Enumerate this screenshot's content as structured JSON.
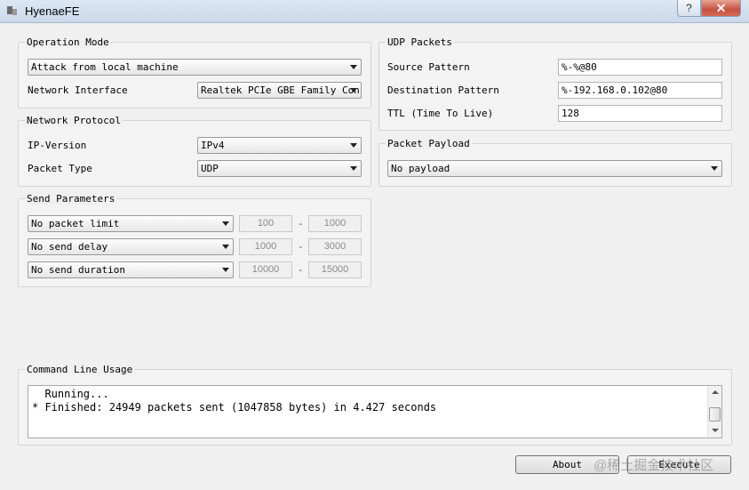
{
  "window": {
    "title": "HyenaeFE",
    "help_label": "?",
    "close_label": "✕"
  },
  "operation_mode": {
    "title": "Operation Mode",
    "mode_value": "Attack from local machine",
    "interface_label": "Network Interface",
    "interface_value": "Realtek PCIe GBE Family Con"
  },
  "network_protocol": {
    "title": "Network Protocol",
    "ip_version_label": "IP-Version",
    "ip_version_value": "IPv4",
    "packet_type_label": "Packet Type",
    "packet_type_value": "UDP"
  },
  "send_parameters": {
    "title": "Send Parameters",
    "rows": [
      {
        "option": "No packet limit",
        "min": "100",
        "max": "1000"
      },
      {
        "option": "No send delay",
        "min": "1000",
        "max": "3000"
      },
      {
        "option": "No send duration",
        "min": "10000",
        "max": "15000"
      }
    ],
    "separator": "-"
  },
  "udp_packets": {
    "title": "UDP Packets",
    "source_label": "Source Pattern",
    "source_value": "%-%@80",
    "destination_label": "Destination Pattern",
    "destination_value": "%-192.168.0.102@80",
    "ttl_label": "TTL (Time To Live)",
    "ttl_value": "128"
  },
  "packet_payload": {
    "title": "Packet Payload",
    "value": "No payload"
  },
  "command_line": {
    "title": "Command Line Usage",
    "lines": [
      "  Running...",
      "* Finished: 24949 packets sent (1047858 bytes) in 4.427 seconds"
    ]
  },
  "buttons": {
    "about": "About",
    "execute": "Execute"
  },
  "watermark": "@稀土掘金技术社区"
}
